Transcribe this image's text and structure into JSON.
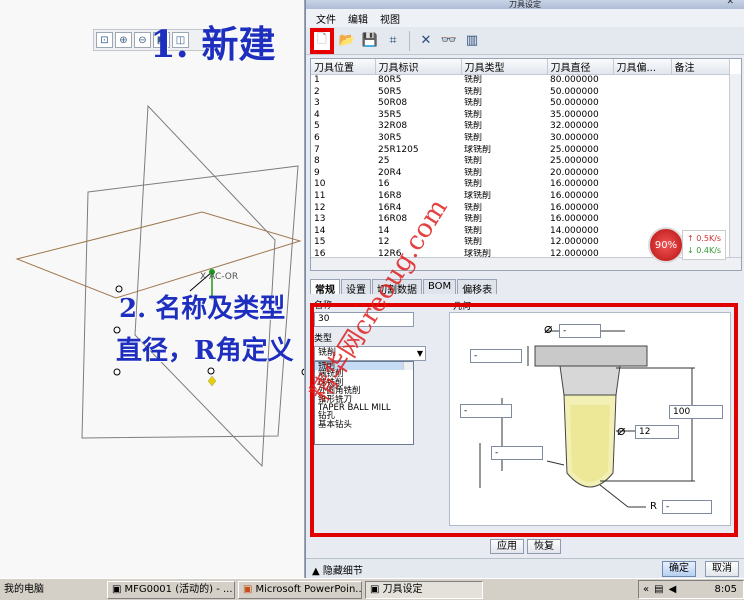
{
  "annotations": {
    "step1": "1. 新建",
    "step2_line1": "2. 名称及类型",
    "step2_line2": "直径，R角定义",
    "watermark": "精华网creoug.com",
    "csys_label": "X  AC-OR"
  },
  "viewport_toolbar": {
    "icons": [
      "zoom-fit-icon",
      "zoom-in-icon",
      "zoom-out-icon",
      "view-orient-icon",
      "display-style-icon"
    ]
  },
  "dialog": {
    "title": "刀具设定",
    "close_glyph": "✕",
    "menu": [
      "文件",
      "编辑",
      "视图"
    ],
    "toolbar_glyphs": {
      "new": "🗋",
      "open": "📂",
      "save": "💾",
      "chart": "⌗",
      "delete": "✕",
      "preview": "👓",
      "table": "▥"
    },
    "table": {
      "columns": [
        "刀具位置",
        "刀具标识",
        "刀具类型",
        "刀具直径",
        "刀具偏...",
        "备注"
      ],
      "rows": [
        [
          "1",
          "80R5",
          "铣削",
          "80.000000",
          "",
          ""
        ],
        [
          "2",
          "50R5",
          "铣削",
          "50.000000",
          "",
          ""
        ],
        [
          "3",
          "50R08",
          "铣削",
          "50.000000",
          "",
          ""
        ],
        [
          "4",
          "35R5",
          "铣削",
          "35.000000",
          "",
          ""
        ],
        [
          "5",
          "32R08",
          "铣削",
          "32.000000",
          "",
          ""
        ],
        [
          "6",
          "30R5",
          "铣削",
          "30.000000",
          "",
          ""
        ],
        [
          "7",
          "25R1205",
          "球铣削",
          "25.000000",
          "",
          ""
        ],
        [
          "8",
          "25",
          "铣削",
          "25.000000",
          "",
          ""
        ],
        [
          "9",
          "20R4",
          "铣削",
          "20.000000",
          "",
          ""
        ],
        [
          "10",
          "16",
          "铣削",
          "16.000000",
          "",
          ""
        ],
        [
          "11",
          "16R8",
          "球铣削",
          "16.000000",
          "",
          ""
        ],
        [
          "12",
          "16R4",
          "铣削",
          "16.000000",
          "",
          ""
        ],
        [
          "13",
          "16R08",
          "铣削",
          "16.000000",
          "",
          ""
        ],
        [
          "14",
          "14",
          "铣削",
          "14.000000",
          "",
          ""
        ],
        [
          "15",
          "12",
          "铣削",
          "12.000000",
          "",
          ""
        ],
        [
          "16",
          "12R6",
          "球铣削",
          "12.000000",
          "",
          ""
        ]
      ]
    },
    "speed_widget": {
      "percent": "90%",
      "up": "↑ 0.5K/s",
      "down": "↓ 0.4K/s"
    },
    "tabs": [
      "常规",
      "设置",
      "切割数据",
      "BOM",
      "偏移表"
    ],
    "form": {
      "name_label": "名称",
      "name_value": "30",
      "type_label": "类型",
      "type_value": "铣削",
      "type_options": [
        "铣削",
        "端铣削",
        "球铣削",
        "外圆角铣削",
        "锥形铣刀",
        "TAPER BALL MILL",
        "钻孔",
        "基本钻头"
      ],
      "geometry_label": "几何",
      "dims": {
        "d_top": "-",
        "h_top": "-",
        "l_left": "-",
        "length": "100",
        "diameter": "12",
        "l_mid": "-",
        "r_label": "R",
        "r_value": "-"
      },
      "diameter_symbol": "⌀"
    },
    "buttons": {
      "apply": "应用",
      "restore": "恢复",
      "hide_details": "隐藏细节",
      "ok": "确定",
      "cancel": "取消"
    }
  },
  "taskbar": {
    "items": [
      "我的电脑",
      "MFG0001 (活动的) - ...",
      "Microsoft PowerPoin...",
      "刀具设定"
    ],
    "clock": "8:05"
  },
  "colors": {
    "annotation_blue": "#1e2fbf",
    "highlight_red": "#e00000"
  }
}
